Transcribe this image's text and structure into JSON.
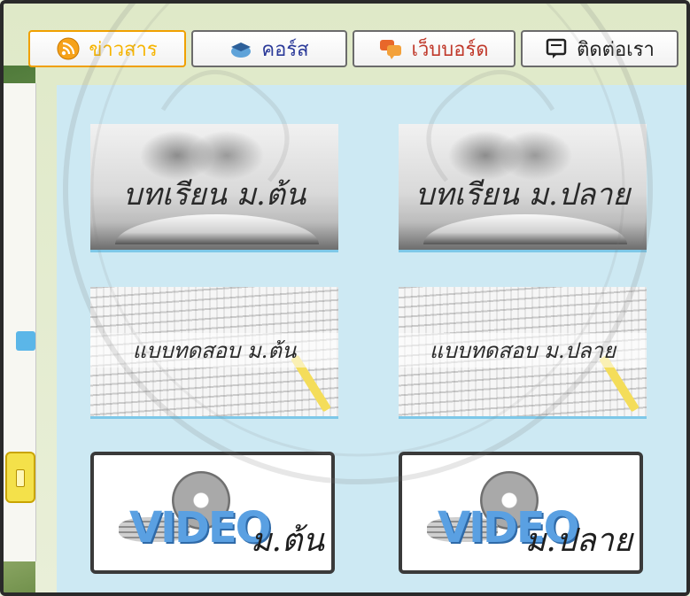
{
  "nav": {
    "items": [
      {
        "label": "ข่าวสาร",
        "icon": "rss-icon",
        "active": true
      },
      {
        "label": "คอร์ส",
        "icon": "graduation-cap-icon",
        "active": false
      },
      {
        "label": "เว็บบอร์ด",
        "icon": "chat-bubbles-icon",
        "active": false
      },
      {
        "label": "ติดต่อเรา",
        "icon": "monitor-chat-icon",
        "active": false
      }
    ]
  },
  "tiles": {
    "lesson_lower": "บทเรียน ม.ต้น",
    "lesson_upper": "บทเรียน ม.ปลาย",
    "exam_lower": "แบบทดสอบ ม.ต้น",
    "exam_upper": "แบบทดสอบ ม.ปลาย",
    "video_word": "VIDEO",
    "video_lower_level": "ม.ต้น",
    "video_upper_level": "ม.ปลาย"
  },
  "colors": {
    "nav_active": "#f6b400",
    "nav_link": "#2b3a99",
    "webboard": "#c0392b",
    "panel_bg": "#cde9f3",
    "video_text": "#5aa0e2"
  }
}
